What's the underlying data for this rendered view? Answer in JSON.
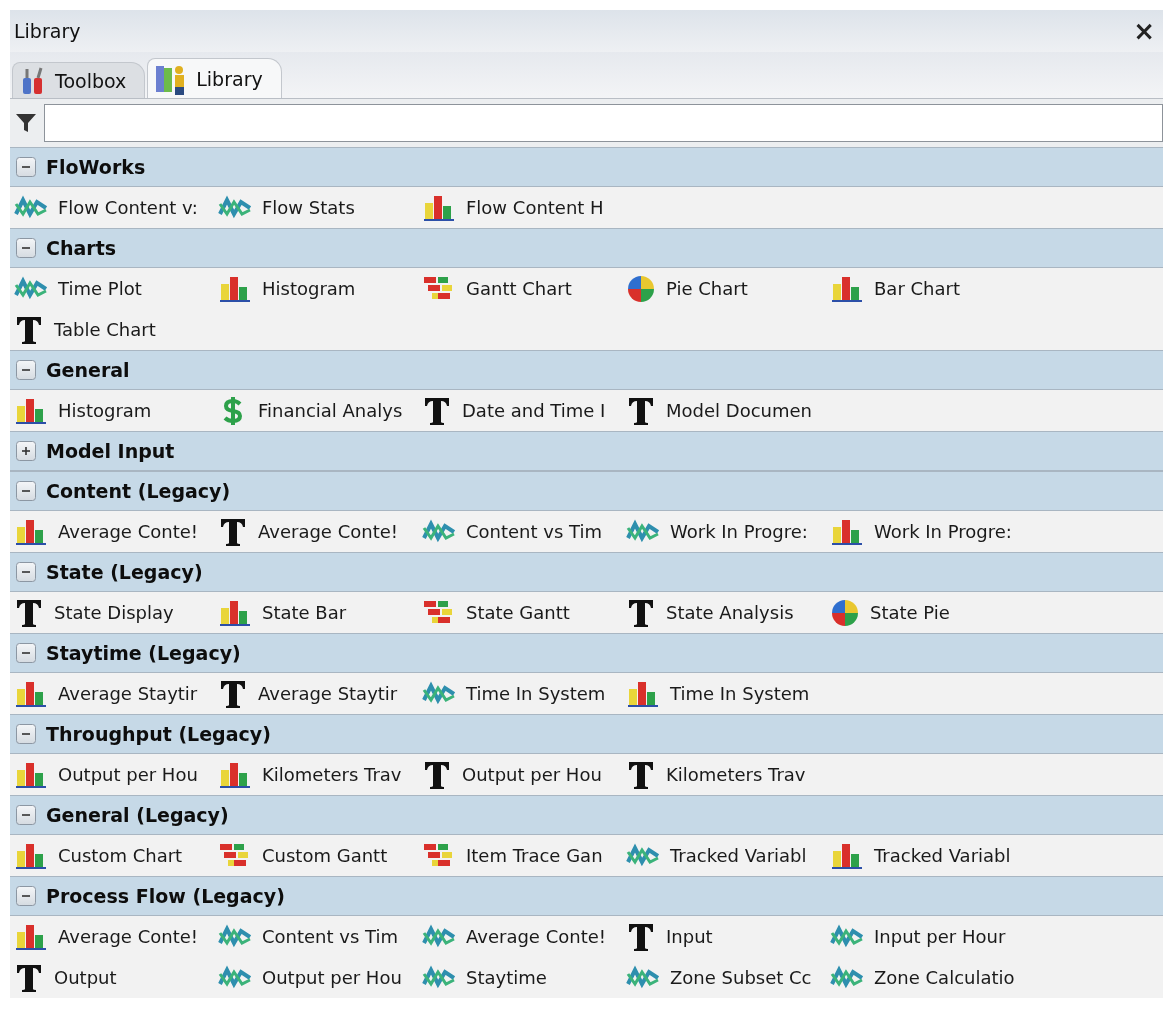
{
  "window": {
    "title": "Library",
    "close": "×"
  },
  "tabs": [
    {
      "label": "Toolbox",
      "selected": false
    },
    {
      "label": "Library",
      "selected": true
    }
  ],
  "sections": [
    {
      "title": "FloWorks",
      "expanded": true,
      "items": [
        {
          "label": "Flow Content v:",
          "kind": "line"
        },
        {
          "label": "Flow Stats",
          "kind": "line"
        },
        {
          "label": "Flow Content H",
          "kind": "bar"
        }
      ]
    },
    {
      "title": "Charts",
      "expanded": true,
      "items": [
        {
          "label": "Time Plot",
          "kind": "line"
        },
        {
          "label": "Histogram",
          "kind": "bar"
        },
        {
          "label": "Gantt Chart",
          "kind": "gantt"
        },
        {
          "label": "Pie Chart",
          "kind": "pie"
        },
        {
          "label": "Bar Chart",
          "kind": "bar"
        },
        {
          "label": "Table Chart",
          "kind": "text"
        }
      ]
    },
    {
      "title": "General",
      "expanded": true,
      "items": [
        {
          "label": "Histogram",
          "kind": "bar"
        },
        {
          "label": "Financial Analys",
          "kind": "dollar"
        },
        {
          "label": "Date and Time I",
          "kind": "text"
        },
        {
          "label": "Model Documen",
          "kind": "text"
        }
      ]
    },
    {
      "title": "Model Input",
      "expanded": false
    },
    {
      "title": "Content (Legacy)",
      "expanded": true,
      "items": [
        {
          "label": "Average Conte!",
          "kind": "bar"
        },
        {
          "label": "Average Conte!",
          "kind": "text"
        },
        {
          "label": "Content vs Tim",
          "kind": "line"
        },
        {
          "label": "Work In Progre:",
          "kind": "line"
        },
        {
          "label": "Work In Progre:",
          "kind": "bar"
        }
      ]
    },
    {
      "title": "State (Legacy)",
      "expanded": true,
      "items": [
        {
          "label": "State Display",
          "kind": "text"
        },
        {
          "label": "State Bar",
          "kind": "bar"
        },
        {
          "label": "State Gantt",
          "kind": "gantt"
        },
        {
          "label": "State Analysis",
          "kind": "text"
        },
        {
          "label": "State Pie",
          "kind": "pie"
        }
      ]
    },
    {
      "title": "Staytime (Legacy)",
      "expanded": true,
      "items": [
        {
          "label": "Average Staytir",
          "kind": "bar"
        },
        {
          "label": "Average Staytir",
          "kind": "text"
        },
        {
          "label": "Time In System",
          "kind": "line"
        },
        {
          "label": "Time In System",
          "kind": "bar"
        }
      ]
    },
    {
      "title": "Throughput (Legacy)",
      "expanded": true,
      "items": [
        {
          "label": "Output per Hou",
          "kind": "bar"
        },
        {
          "label": "Kilometers Trav",
          "kind": "bar"
        },
        {
          "label": "Output per Hou",
          "kind": "text"
        },
        {
          "label": "Kilometers Trav",
          "kind": "text"
        }
      ]
    },
    {
      "title": "General (Legacy)",
      "expanded": true,
      "items": [
        {
          "label": "Custom Chart",
          "kind": "bar"
        },
        {
          "label": "Custom Gantt",
          "kind": "gantt"
        },
        {
          "label": "Item Trace Gan",
          "kind": "gantt"
        },
        {
          "label": "Tracked Variabl",
          "kind": "line"
        },
        {
          "label": "Tracked Variabl",
          "kind": "bar"
        }
      ]
    },
    {
      "title": "Process Flow (Legacy)",
      "expanded": true,
      "items": [
        {
          "label": "Average Conte!",
          "kind": "bar"
        },
        {
          "label": "Content vs Tim",
          "kind": "line"
        },
        {
          "label": "Average Conte!",
          "kind": "line"
        },
        {
          "label": "Input",
          "kind": "text"
        },
        {
          "label": "Input per Hour",
          "kind": "line"
        },
        {
          "label": "Output",
          "kind": "text"
        },
        {
          "label": "Output per Hou",
          "kind": "line"
        },
        {
          "label": "Staytime",
          "kind": "line"
        },
        {
          "label": "Zone Subset Cc",
          "kind": "line"
        },
        {
          "label": "Zone Calculatio",
          "kind": "line"
        }
      ]
    }
  ]
}
